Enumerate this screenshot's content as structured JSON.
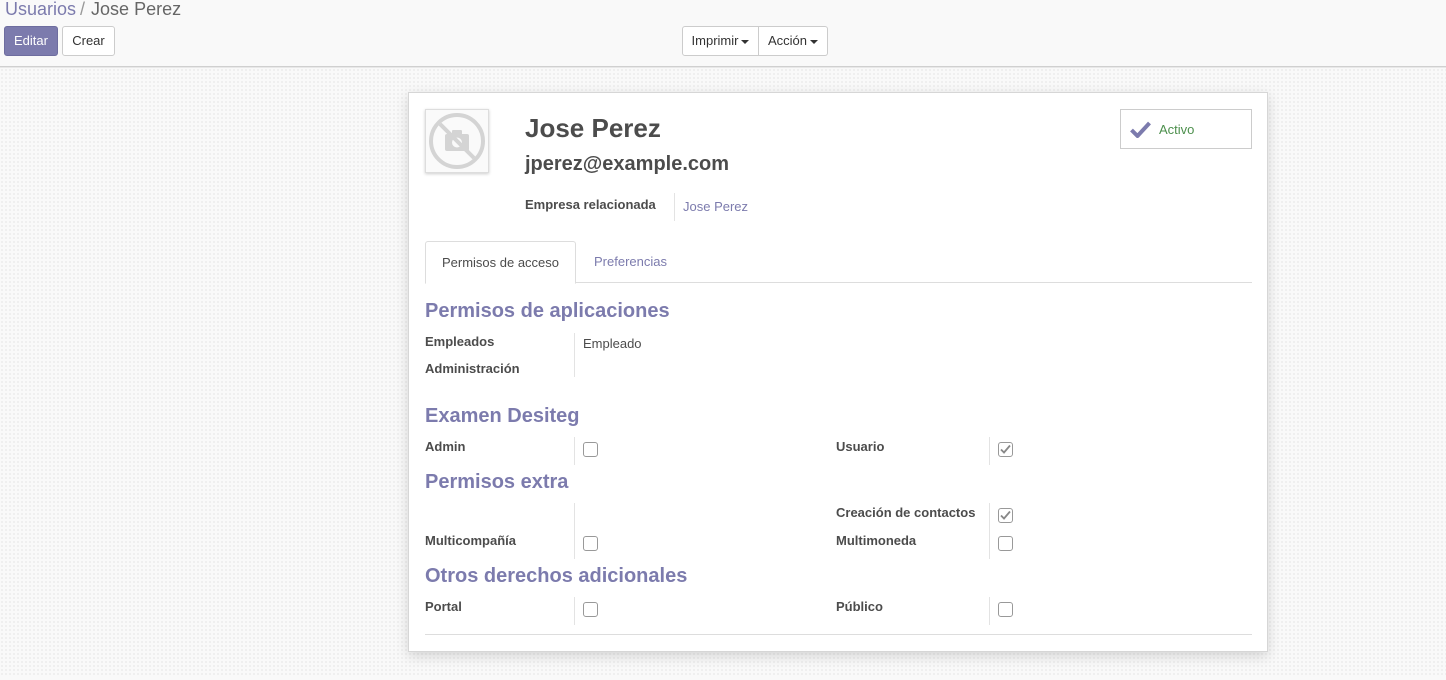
{
  "breadcrumb": {
    "parent": "Usuarios",
    "separator": "/",
    "current": "Jose Perez"
  },
  "toolbar": {
    "edit_label": "Editar",
    "create_label": "Crear",
    "print_label": "Imprimir",
    "action_label": "Acción"
  },
  "user": {
    "name": "Jose Perez",
    "email": "jperez@example.com",
    "avatar_icon": "camera-placeholder-icon",
    "related_company_label": "Empresa relacionada",
    "related_company_value": "Jose Perez",
    "active_label": "Activo",
    "active_icon": "check-icon"
  },
  "tabs": [
    {
      "label": "Permisos de acceso",
      "active": true
    },
    {
      "label": "Preferencias",
      "active": false
    }
  ],
  "sections": {
    "app_permissions": {
      "title": "Permisos de aplicaciones",
      "fields": [
        {
          "label": "Empleados",
          "value": "Empleado"
        },
        {
          "label": "Administración",
          "value": ""
        }
      ]
    },
    "exam": {
      "title": "Examen Desiteg",
      "left": {
        "label": "Admin",
        "checked": false
      },
      "right": {
        "label": "Usuario",
        "checked": true
      }
    },
    "extra": {
      "title": "Permisos extra",
      "contacts": {
        "label": "Creación de contactos",
        "checked": true
      },
      "multicompany": {
        "label": "Multicompañía",
        "checked": false
      },
      "multicurrency": {
        "label": "Multimoneda",
        "checked": false
      }
    },
    "other": {
      "title": "Otros derechos adicionales",
      "portal": {
        "label": "Portal",
        "checked": false
      },
      "public": {
        "label": "Público",
        "checked": false
      }
    }
  },
  "colors": {
    "brand": "#7c7bad",
    "active_green": "#4c8f4c"
  }
}
